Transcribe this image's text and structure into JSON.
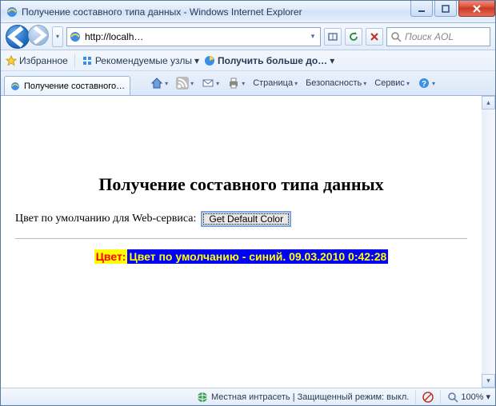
{
  "window": {
    "title": "Получение составного типа данных - Windows Internet Explorer"
  },
  "nav": {
    "url": "http://localh…",
    "search_placeholder": "Поиск AOL"
  },
  "favbar": {
    "favorites": "Избранное",
    "suggested": "Рекомендуемые узлы",
    "getmore": "Получить больше до…"
  },
  "tab": {
    "title": "Получение составного…"
  },
  "toolbar": {
    "page": "Страница",
    "safety": "Безопасность",
    "service": "Сервис"
  },
  "page": {
    "heading": "Получение составного типа данных",
    "prompt": "Цвет по умолчанию для Web-сервиса:",
    "button": "Get Default Color",
    "result_label": "Цвет:",
    "result_value": "Цвет по умолчанию - синий. 09.03.2010 0:42:28"
  },
  "status": {
    "zone": "Местная интрасеть | Защищенный режим: выкл.",
    "zoom": "100%"
  }
}
